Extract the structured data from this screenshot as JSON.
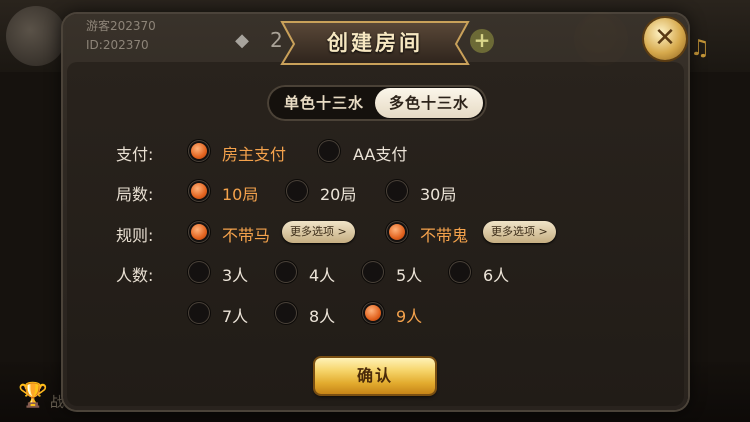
{
  "user": {
    "name": "游客202370",
    "id": "ID:202370",
    "coins": "2"
  },
  "dialog": {
    "title": "创建房间",
    "tabs": [
      {
        "label": "单色十三水",
        "active": false
      },
      {
        "label": "多色十三水",
        "active": true
      }
    ],
    "payment": {
      "label": "支付:",
      "options": [
        {
          "label": "房主支付",
          "selected": true
        },
        {
          "label": "AA支付",
          "selected": false
        }
      ]
    },
    "rounds": {
      "label": "局数:",
      "options": [
        {
          "label": "10局",
          "selected": true
        },
        {
          "label": "20局",
          "selected": false
        },
        {
          "label": "30局",
          "selected": false
        }
      ]
    },
    "rules": {
      "label": "规则:",
      "options": [
        {
          "label": "不带马",
          "selected": true
        },
        {
          "label": "不带鬼",
          "selected": true
        }
      ],
      "more_label": "更多选项 >"
    },
    "players": {
      "label": "人数:",
      "options": [
        {
          "label": "3人",
          "selected": false
        },
        {
          "label": "4人",
          "selected": false
        },
        {
          "label": "5人",
          "selected": false
        },
        {
          "label": "6人",
          "selected": false
        },
        {
          "label": "7人",
          "selected": false
        },
        {
          "label": "8人",
          "selected": false
        },
        {
          "label": "9人",
          "selected": true
        }
      ]
    },
    "confirm_label": "确认"
  },
  "background": {
    "bottom_text": "战"
  },
  "colors": {
    "accent": "#f4a24c",
    "gold": "#e2ab2e",
    "panel": "#2f2923"
  }
}
